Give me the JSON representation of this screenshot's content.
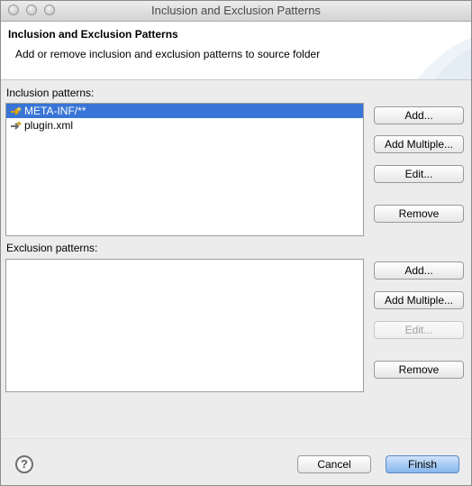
{
  "window": {
    "title": "Inclusion and Exclusion Patterns"
  },
  "header": {
    "title": "Inclusion and Exclusion Patterns",
    "description": "Add or remove inclusion and exclusion patterns to source folder"
  },
  "inclusion": {
    "label": "Inclusion patterns:",
    "items": [
      {
        "text": "META-INF/**",
        "icon": "inclusion-pattern-icon",
        "selected": true
      },
      {
        "text": "plugin.xml",
        "icon": "inclusion-pattern-icon",
        "selected": false
      }
    ],
    "buttons": {
      "add": "Add...",
      "add_multiple": "Add Multiple...",
      "edit": "Edit...",
      "remove": "Remove"
    }
  },
  "exclusion": {
    "label": "Exclusion patterns:",
    "items": [],
    "buttons": {
      "add": "Add...",
      "add_multiple": "Add Multiple...",
      "edit": "Edit...",
      "remove": "Remove"
    },
    "edit_enabled": false
  },
  "footer": {
    "help": "?",
    "cancel": "Cancel",
    "finish": "Finish"
  },
  "colors": {
    "selection": "#3875d7",
    "primary_button": "#86b6ee"
  }
}
